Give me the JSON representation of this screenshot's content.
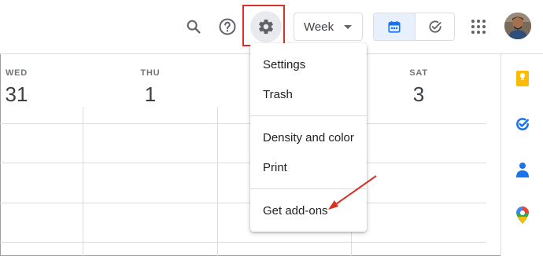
{
  "toolbar": {
    "search_icon": "search-icon",
    "help_icon": "help-icon",
    "settings_icon": "gear-icon",
    "view_select": "Week",
    "calendar_view_icon": "calendar-icon",
    "tasks_view_icon": "check-circle-icon",
    "apps_icon": "apps-grid-icon"
  },
  "days": [
    {
      "name": "WED",
      "number": "31"
    },
    {
      "name": "THU",
      "number": "1"
    },
    {
      "name": "SAT",
      "number": "3"
    }
  ],
  "settings_menu": {
    "items": [
      "Settings",
      "Trash",
      "Density and color",
      "Print",
      "Get add-ons"
    ]
  },
  "side_panel": {
    "icons": [
      "keep-icon",
      "tasks-icon",
      "contacts-icon",
      "maps-icon"
    ]
  },
  "colors": {
    "accent_blue": "#1a73e8",
    "highlight_red": "#d93025",
    "keep_yellow": "#fbbc04",
    "toggle_active_bg": "#e8f0fe"
  }
}
